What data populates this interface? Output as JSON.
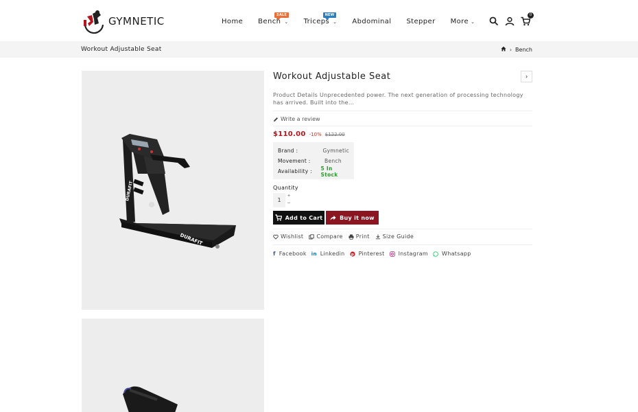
{
  "header": {
    "brand": "GYMNETIC",
    "nav": [
      {
        "label": "Home",
        "badge": "",
        "has_menu": false
      },
      {
        "label": "Bench",
        "badge": "SALE",
        "has_menu": true
      },
      {
        "label": "Triceps",
        "badge": "NEW",
        "has_menu": true
      },
      {
        "label": "Abdominal",
        "badge": "",
        "has_menu": false
      },
      {
        "label": "Stepper",
        "badge": "",
        "has_menu": false
      },
      {
        "label": "More",
        "badge": "",
        "has_menu": true
      }
    ],
    "cart_count": "0",
    "icons": [
      "search-icon",
      "user-icon",
      "cart-icon"
    ]
  },
  "breadcrumb": {
    "page_title": "Workout Adjustable Seat",
    "home_icon": "home-icon",
    "current": "Bench"
  },
  "product": {
    "title": "Workout Adjustable Seat",
    "description": "Product Details Unprecedented power. The next generation of processing technology has arrived. Built into the...",
    "write_review": "Write a review",
    "price": "$110.00",
    "discount": "-10%",
    "old_price": "$122.00",
    "attributes": [
      {
        "key": "Brand :",
        "value": "Gymnetic"
      },
      {
        "key": "Movement :",
        "value": "Bench"
      },
      {
        "key": "Availability :",
        "value": "5 In Stock"
      }
    ],
    "quantity_label": "Quantity",
    "quantity_value": "1",
    "add_to_cart": "Add to Cart",
    "buy_now": "Buy it now",
    "actions": [
      "Wishlist",
      "Compare",
      "Print",
      "Size Guide"
    ],
    "share": [
      {
        "label": "Facebook",
        "color": "#3b5998"
      },
      {
        "label": "Linkedin",
        "color": "#0077b5"
      },
      {
        "label": "Pinterest",
        "color": "#cb2027"
      },
      {
        "label": "Instagram",
        "color": "#c13584"
      },
      {
        "label": "Whatsapp",
        "color": "#25d366"
      }
    ],
    "image_text": "DURAFIT"
  },
  "colors": {
    "accent": "#8b1520",
    "price": "#b3161e",
    "stock": "#2f9a2f",
    "breadcrumb_bg": "#f4f4f4",
    "image_bg": "#ededed"
  }
}
